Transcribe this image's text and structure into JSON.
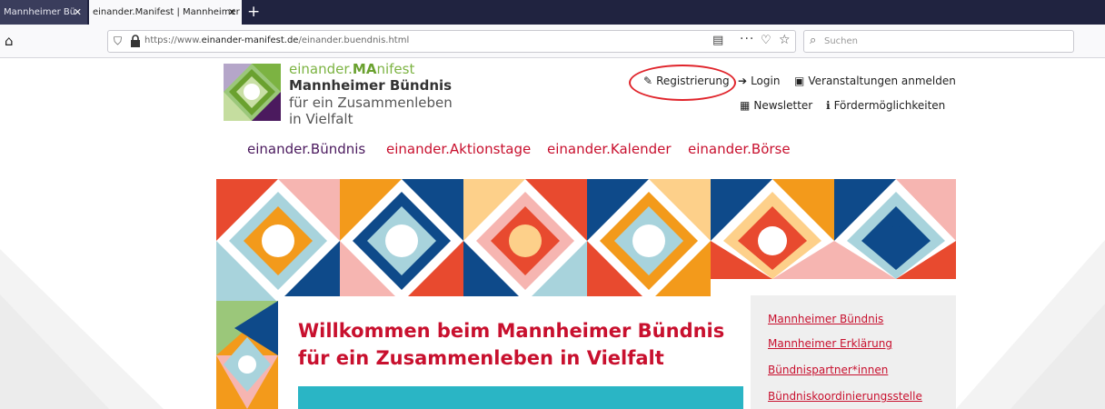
{
  "browser": {
    "tabs": [
      {
        "title": "Mannheimer Bü"
      },
      {
        "title": "einander.Manifest | Mannheimer Bü"
      }
    ],
    "url_prefix": "https://www.",
    "url_domain": "einander-manifest.de",
    "url_path": "/einander.buendnis.html",
    "search_placeholder": "Suchen"
  },
  "header": {
    "brand_prefix": "einander.",
    "brand_bold": "MA",
    "brand_suffix": "nifest",
    "org_name": "Mannheimer Bündnis",
    "tagline_1": "für ein Zusammenleben",
    "tagline_2": "in Vielfalt"
  },
  "toplinks": {
    "register": "Registrierung",
    "login": "Login",
    "events": "Veranstaltungen anmelden",
    "newsletter": "Newsletter",
    "funding": "Fördermöglichkeiten"
  },
  "mainnav": [
    "einander.Bündnis",
    "einander.Aktionstage",
    "einander.Kalender",
    "einander.Börse"
  ],
  "welcome": {
    "line1": "Willkommen beim Mannheimer Bündnis",
    "line2": "für ein Zusammenleben in Vielfalt"
  },
  "sidebar": [
    "Mannheimer Bündnis",
    "Mannheimer Erklärung",
    "Bündnispartner*innen",
    "Bündniskoordinierungsstelle"
  ],
  "colors": {
    "accent_red": "#c8102e",
    "brand_green": "#7cb342",
    "nav_active": "#4b1a5e",
    "teal": "#2ab5c5",
    "highlight_oval": "#e0242b"
  }
}
